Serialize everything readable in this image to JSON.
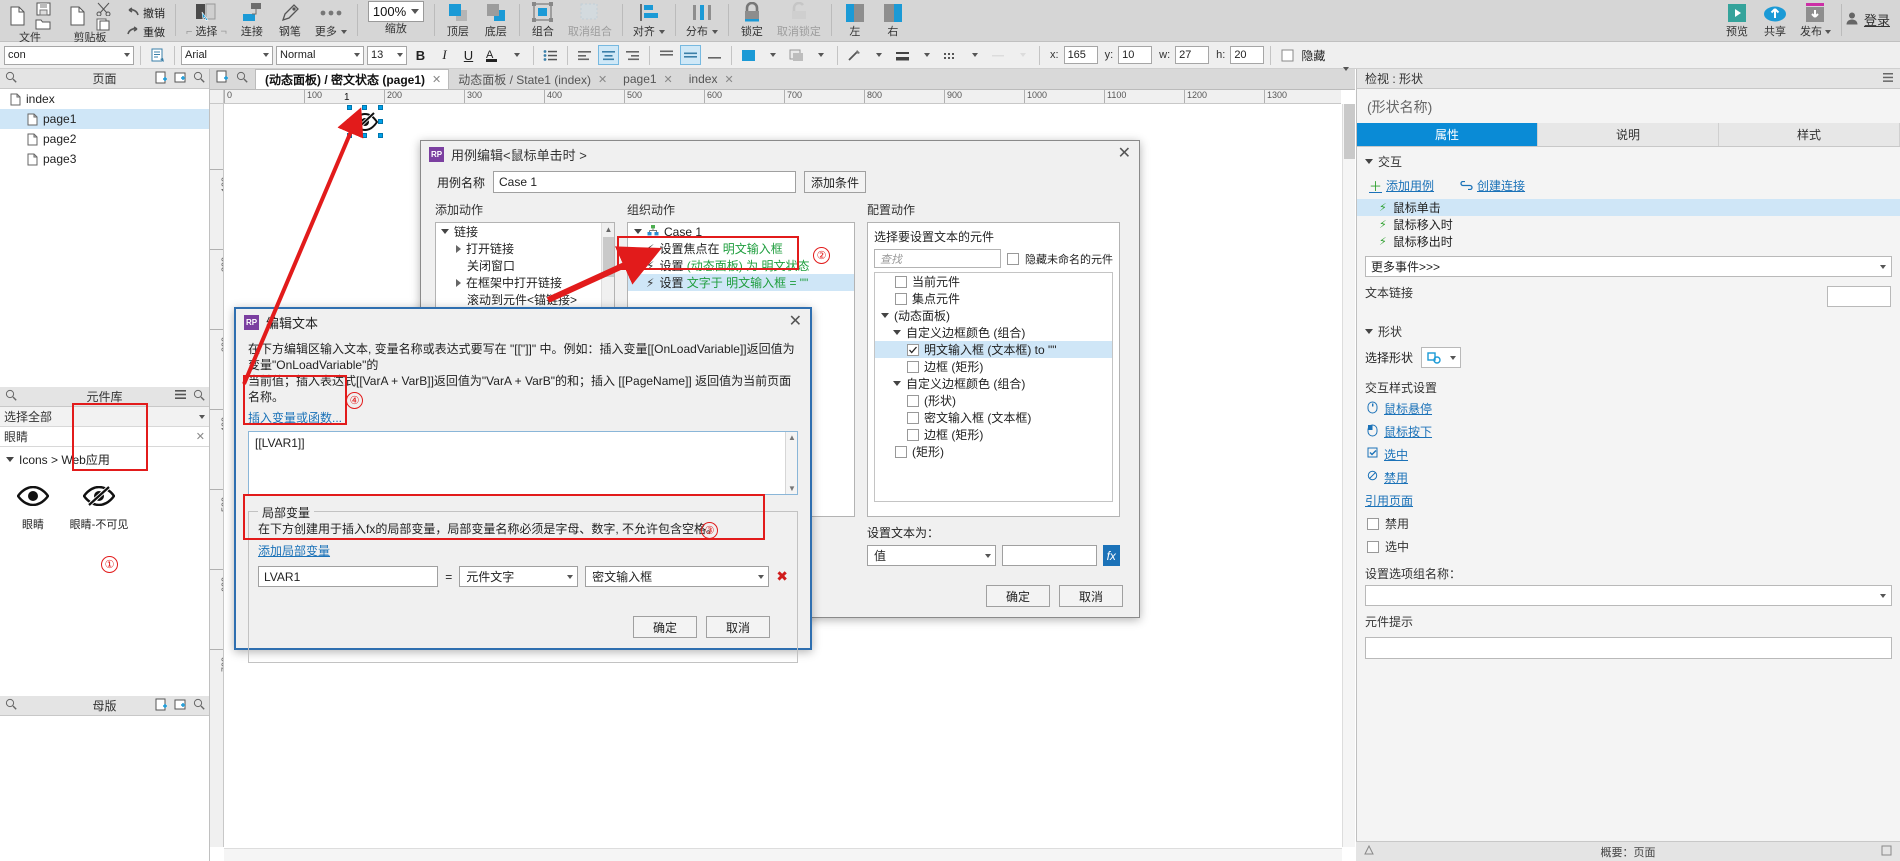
{
  "ribbon": {
    "groups": [
      {
        "name": "file",
        "label": "文件",
        "icons": [
          "new-page-icon",
          "save-icon",
          "open-folder-icon"
        ]
      },
      {
        "name": "clipboard",
        "label": "剪贴板",
        "icons": [
          "copy-icon",
          "paste-icon"
        ]
      },
      {
        "name": "undo",
        "items": [
          {
            "label": "撤销",
            "icon": "undo-icon"
          },
          {
            "label": "重做",
            "icon": "redo-icon"
          }
        ]
      },
      {
        "name": "select",
        "label": "选择",
        "icon": "select-icon"
      },
      {
        "name": "connect",
        "label": "连接",
        "icon": "connector-icon"
      },
      {
        "name": "pen",
        "label": "钢笔",
        "icon": "pen-icon"
      },
      {
        "name": "more",
        "label": "更多",
        "icon": "ellipsis-icon",
        "has_caret": true
      },
      {
        "name": "zoom",
        "label": "缩放",
        "value": "100%"
      },
      {
        "name": "bring-front",
        "label": "顶层",
        "icon": "bring-to-front-icon"
      },
      {
        "name": "send-back",
        "label": "底层",
        "icon": "send-to-back-icon"
      },
      {
        "name": "group",
        "label": "组合",
        "icon": "group-icon"
      },
      {
        "name": "ungroup",
        "label": "取消组合",
        "icon": "ungroup-icon",
        "disabled": true
      },
      {
        "name": "align",
        "label": "对齐",
        "icon": "align-icon",
        "has_caret": true
      },
      {
        "name": "distribute",
        "label": "分布",
        "icon": "distribute-icon",
        "has_caret": true
      },
      {
        "name": "lock",
        "label": "锁定",
        "icon": "lock-icon"
      },
      {
        "name": "unlock",
        "label": "取消锁定",
        "icon": "unlock-icon",
        "disabled": true
      },
      {
        "name": "left-panel",
        "label": "左",
        "icon": "panel-left-icon"
      },
      {
        "name": "right-panel",
        "label": "右",
        "icon": "panel-right-icon"
      }
    ],
    "right_actions": [
      {
        "name": "preview",
        "label": "预览",
        "icon": "play-icon",
        "color": "#35a39b"
      },
      {
        "name": "share",
        "label": "共享",
        "icon": "cloud-up-icon",
        "color": "#1b9ad6"
      },
      {
        "name": "publish",
        "label": "发布",
        "icon": "publish-icon",
        "color": "#8a8a8a",
        "has_caret": true
      }
    ],
    "login_label": "登录"
  },
  "formatbar": {
    "widget_name": "con",
    "font": "Arial",
    "style": "Normal",
    "size": "13",
    "bold": "B",
    "italic": "I",
    "underline": "U",
    "x_label": "x:",
    "x_value": "165",
    "y_label": "y:",
    "y_value": "10",
    "w_label": "w:",
    "w_value": "27",
    "h_label": "h:",
    "h_value": "20",
    "hidden_label": "隐藏"
  },
  "pages_panel": {
    "title": "页面",
    "items": [
      {
        "label": "index",
        "indent": false,
        "selected": false
      },
      {
        "label": "page1",
        "indent": true,
        "selected": true
      },
      {
        "label": "page2",
        "indent": true,
        "selected": false
      },
      {
        "label": "page3",
        "indent": true,
        "selected": false
      }
    ]
  },
  "masters_panel": {
    "title": "母版"
  },
  "library_panel": {
    "title": "元件库",
    "filter": "选择全部",
    "search_value": "眼睛",
    "category": "Icons > Web应用",
    "items": [
      {
        "label": "眼睛",
        "icon": "eye-icon",
        "highlighted": false
      },
      {
        "label": "眼睛-不可见",
        "icon": "eye-off-icon",
        "highlighted": true
      }
    ],
    "annotation": "①"
  },
  "tabs": [
    {
      "label": "(动态面板) / 密文状态 (page1)",
      "active": true
    },
    {
      "label": "动态面板 / State1 (index)",
      "active": false
    },
    {
      "label": "page1",
      "active": false
    },
    {
      "label": "index",
      "active": false
    }
  ],
  "canvas": {
    "ruler_h": [
      "0",
      "100",
      "200",
      "300",
      "400",
      "500",
      "600",
      "700",
      "800",
      "900",
      "1000",
      "1100",
      "1200",
      "1300"
    ],
    "ruler_v": [
      "100",
      "200",
      "300",
      "400",
      "500",
      "600",
      "700"
    ],
    "selected_widget_label": "1"
  },
  "case_dialog": {
    "title": "用例编辑<鼠标单击时 >",
    "case_name_label": "用例名称",
    "case_name_value": "Case 1",
    "add_condition_button": "添加条件",
    "columns": {
      "add_action": "添加动作",
      "organize_action": "组织动作",
      "configure_action": "配置动作"
    },
    "action_tree": [
      {
        "label": "链接",
        "level": 0,
        "expanded": true
      },
      {
        "label": "打开链接",
        "level": 1,
        "expanded": false
      },
      {
        "label": "关闭窗口",
        "level": 1,
        "leaf": true
      },
      {
        "label": "在框架中打开链接",
        "level": 1,
        "expanded": false
      },
      {
        "label": "滚动到元件<锚链接>",
        "level": 1,
        "leaf": true
      }
    ],
    "organize_tree": [
      {
        "label": "Case 1",
        "icon": "case-icon",
        "level": 0
      },
      {
        "label": "设置焦点在 ",
        "highlight": "明文输入框",
        "icon": "bolt-icon",
        "level": 1
      },
      {
        "label": "设置 ",
        "highlight": "(动态面板) 为 明文状态",
        "icon": "bolt-icon",
        "level": 1
      },
      {
        "label": "设置 ",
        "highlight": "文字于 明文输入框 = \"\"",
        "icon": "bolt-icon",
        "level": 1,
        "selected": true
      }
    ],
    "annotation_2": "②",
    "configure": {
      "select_label": "选择要设置文本的元件",
      "search_placeholder": "查找",
      "hide_unnamed_label": "隐藏未命名的元件",
      "tree": [
        {
          "label": "当前元件",
          "indent": 1,
          "checkbox": "unchecked"
        },
        {
          "label": "集点元件",
          "indent": 1,
          "checkbox": "unchecked"
        },
        {
          "label": "(动态面板)",
          "indent": 0,
          "arrow": true
        },
        {
          "label": "自定义边框颜色 (组合)",
          "indent": 1,
          "arrow": true
        },
        {
          "label": "明文输入框 (文本框) to \"\"",
          "indent": 2,
          "checkbox": "checked",
          "selected": true
        },
        {
          "label": "边框 (矩形)",
          "indent": 2,
          "checkbox": "unchecked"
        },
        {
          "label": "自定义边框颜色 (组合)",
          "indent": 1,
          "arrow": true
        },
        {
          "label": "(形状)",
          "indent": 2,
          "checkbox": "unchecked"
        },
        {
          "label": "密文输入框 (文本框)",
          "indent": 2,
          "checkbox": "unchecked"
        },
        {
          "label": "边框 (矩形)",
          "indent": 2,
          "checkbox": "unchecked"
        },
        {
          "label": "(矩形)",
          "indent": 1,
          "checkbox": "unchecked"
        }
      ],
      "set_text_label": "设置文本为：",
      "value_select": "值",
      "value_input": "",
      "fx_button": "fx"
    },
    "ok_button": "确定",
    "cancel_button": "取消"
  },
  "text_dialog": {
    "title": "编辑文本",
    "hint_line1": "在下方编辑区输入文本, 变量名称或表达式要写在 \"[[\"]]\" 中。例如：插入变量[[OnLoadVariable]]返回值为变量\"OnLoadVariable\"的",
    "hint_line2": "当前值；插入表达式[[VarA + VarB]]返回值为\"VarA + VarB\"的和；插入 [[PageName]] 返回值为当前页面名称。",
    "insert_var_link": "插入变量或函数...",
    "editor_value": "[[LVAR1]]",
    "annotation_4": "④",
    "local_vars": {
      "group_title": "局部变量",
      "description": "在下方创建用于插入fx的局部变量，局部变量名称必须是字母、数字, 不允许包含空格。",
      "add_link": "添加局部变量",
      "rows": [
        {
          "name": "LVAR1",
          "eq": "=",
          "type": "元件文字",
          "target": "密文输入框",
          "annotation": "③"
        }
      ],
      "delete_icon": "delete-x-icon"
    },
    "ok_button": "确定",
    "cancel_button": "取消"
  },
  "inspector": {
    "header": "检视 : 形状",
    "shape_name": "(形状名称)",
    "tabs": [
      {
        "label": "属性",
        "active": true
      },
      {
        "label": "说明",
        "active": false
      },
      {
        "label": "样式",
        "active": false
      }
    ],
    "interaction_section": "交互",
    "add_usecase_link": "添加用例",
    "create_link_link": "创建连接",
    "events": [
      {
        "label": "鼠标单击",
        "selected": true
      },
      {
        "label": "鼠标移入时",
        "selected": false
      },
      {
        "label": "鼠标移出时",
        "selected": false
      }
    ],
    "more_events": "更多事件>>>",
    "text_link_label": "文本链接",
    "shape_section": "形状",
    "select_shape_label": "选择形状",
    "interaction_style_label": "交互样式设置",
    "style_items": [
      {
        "label": "鼠标悬停",
        "icon": "mouse-hover-icon"
      },
      {
        "label": "鼠标按下",
        "icon": "mouse-down-icon"
      },
      {
        "label": "选中",
        "icon": "selected-icon"
      },
      {
        "label": "禁用",
        "icon": "disabled-icon"
      }
    ],
    "reference_page_link": "引用页面",
    "checkboxes": [
      {
        "label": "禁用",
        "checked": false
      },
      {
        "label": "选中",
        "checked": false
      }
    ],
    "group_name_label": "设置选项组名称：",
    "group_name_value": "",
    "tooltip_label": "元件提示",
    "tooltip_value": "",
    "status": "概要：页面"
  },
  "colors": {
    "accent": "#0a8bd6",
    "annotation_red": "#e21b1b",
    "highlight_green": "#1f9e3e",
    "selection_blue": "#cfe6f7",
    "purple_logo": "#7b3fa0"
  }
}
